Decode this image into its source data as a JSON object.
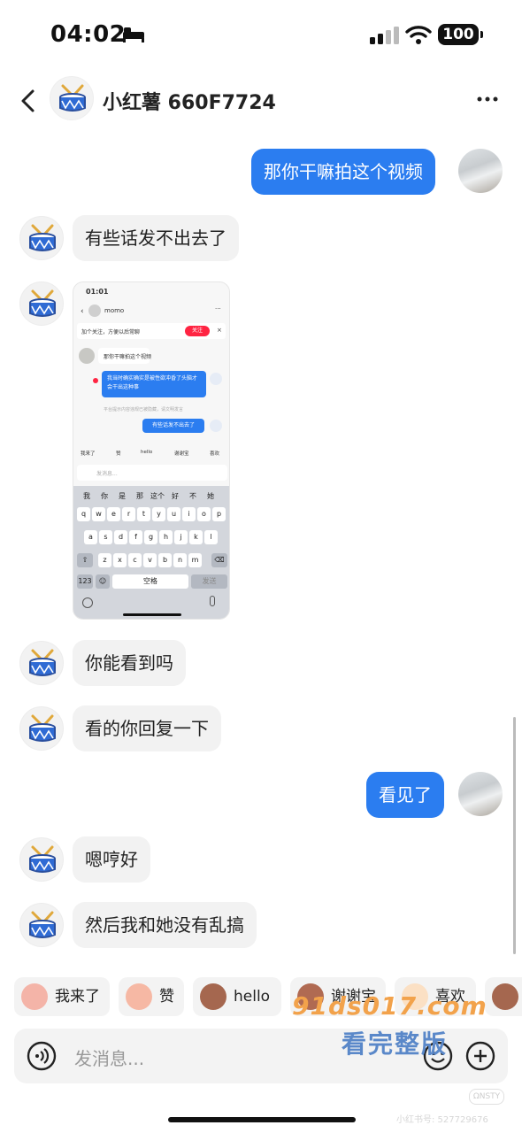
{
  "status_bar": {
    "time": "04:02",
    "battery": "100"
  },
  "header": {
    "contact_name": "小红薯 660F7724"
  },
  "messages": [
    {
      "side": "out",
      "text": "那你干嘛拍这个视频"
    },
    {
      "side": "in",
      "text": "有些话发不出去了"
    },
    {
      "side": "in",
      "text": "你能看到吗"
    },
    {
      "side": "in",
      "text": "看的你回复一下"
    },
    {
      "side": "out",
      "text": "看见了"
    },
    {
      "side": "in",
      "text": "嗯哼好"
    },
    {
      "side": "in",
      "text": "然后我和她没有乱搞"
    }
  ],
  "screenshot": {
    "time": "01:01",
    "contact": "momo",
    "follow_banner": "加个关注，方便以后常聊",
    "follow_button": "关注",
    "msg1": "那你干嘛拍这个视频",
    "msg2": "我当时确实确实是被性欲冲昏了头脑才会干出这种事",
    "notice": "平台提示内容违规已被隐藏，请文明发言",
    "msg3": "有些话发不出去了",
    "chips": [
      "我来了",
      "赞",
      "hello",
      "谢谢宝",
      "喜欢"
    ],
    "input_placeholder": "发消息...",
    "suggestions": [
      "我",
      "你",
      "是",
      "那",
      "这个",
      "好",
      "不",
      "她"
    ],
    "row1": [
      "q",
      "w",
      "e",
      "r",
      "t",
      "y",
      "u",
      "i",
      "o",
      "p"
    ],
    "row2": [
      "a",
      "s",
      "d",
      "f",
      "g",
      "h",
      "j",
      "k",
      "l"
    ],
    "row3": [
      "z",
      "x",
      "c",
      "v",
      "b",
      "n",
      "m"
    ],
    "num_key": "123",
    "space_key": "空格",
    "send_key": "发送"
  },
  "quick_replies": [
    "我来了",
    "赞",
    "hello",
    "谢谢宝",
    "喜欢"
  ],
  "input": {
    "placeholder": "发消息..."
  },
  "watermark": {
    "site": "91ds017.com",
    "text": "看完整版"
  },
  "footer": {
    "id_text": "小红书号: 527729676",
    "tag": "ΩNSTY"
  },
  "colors": {
    "accent": "#2b7df0",
    "bubble_in": "#f2f2f2",
    "watermark_orange": "#f2a24b",
    "watermark_blue": "#5a88c9"
  },
  "icons": [
    "back-chevron-icon",
    "more-dots-icon",
    "voice-icon",
    "emoji-icon",
    "add-icon",
    "drum-avatar-icon"
  ]
}
